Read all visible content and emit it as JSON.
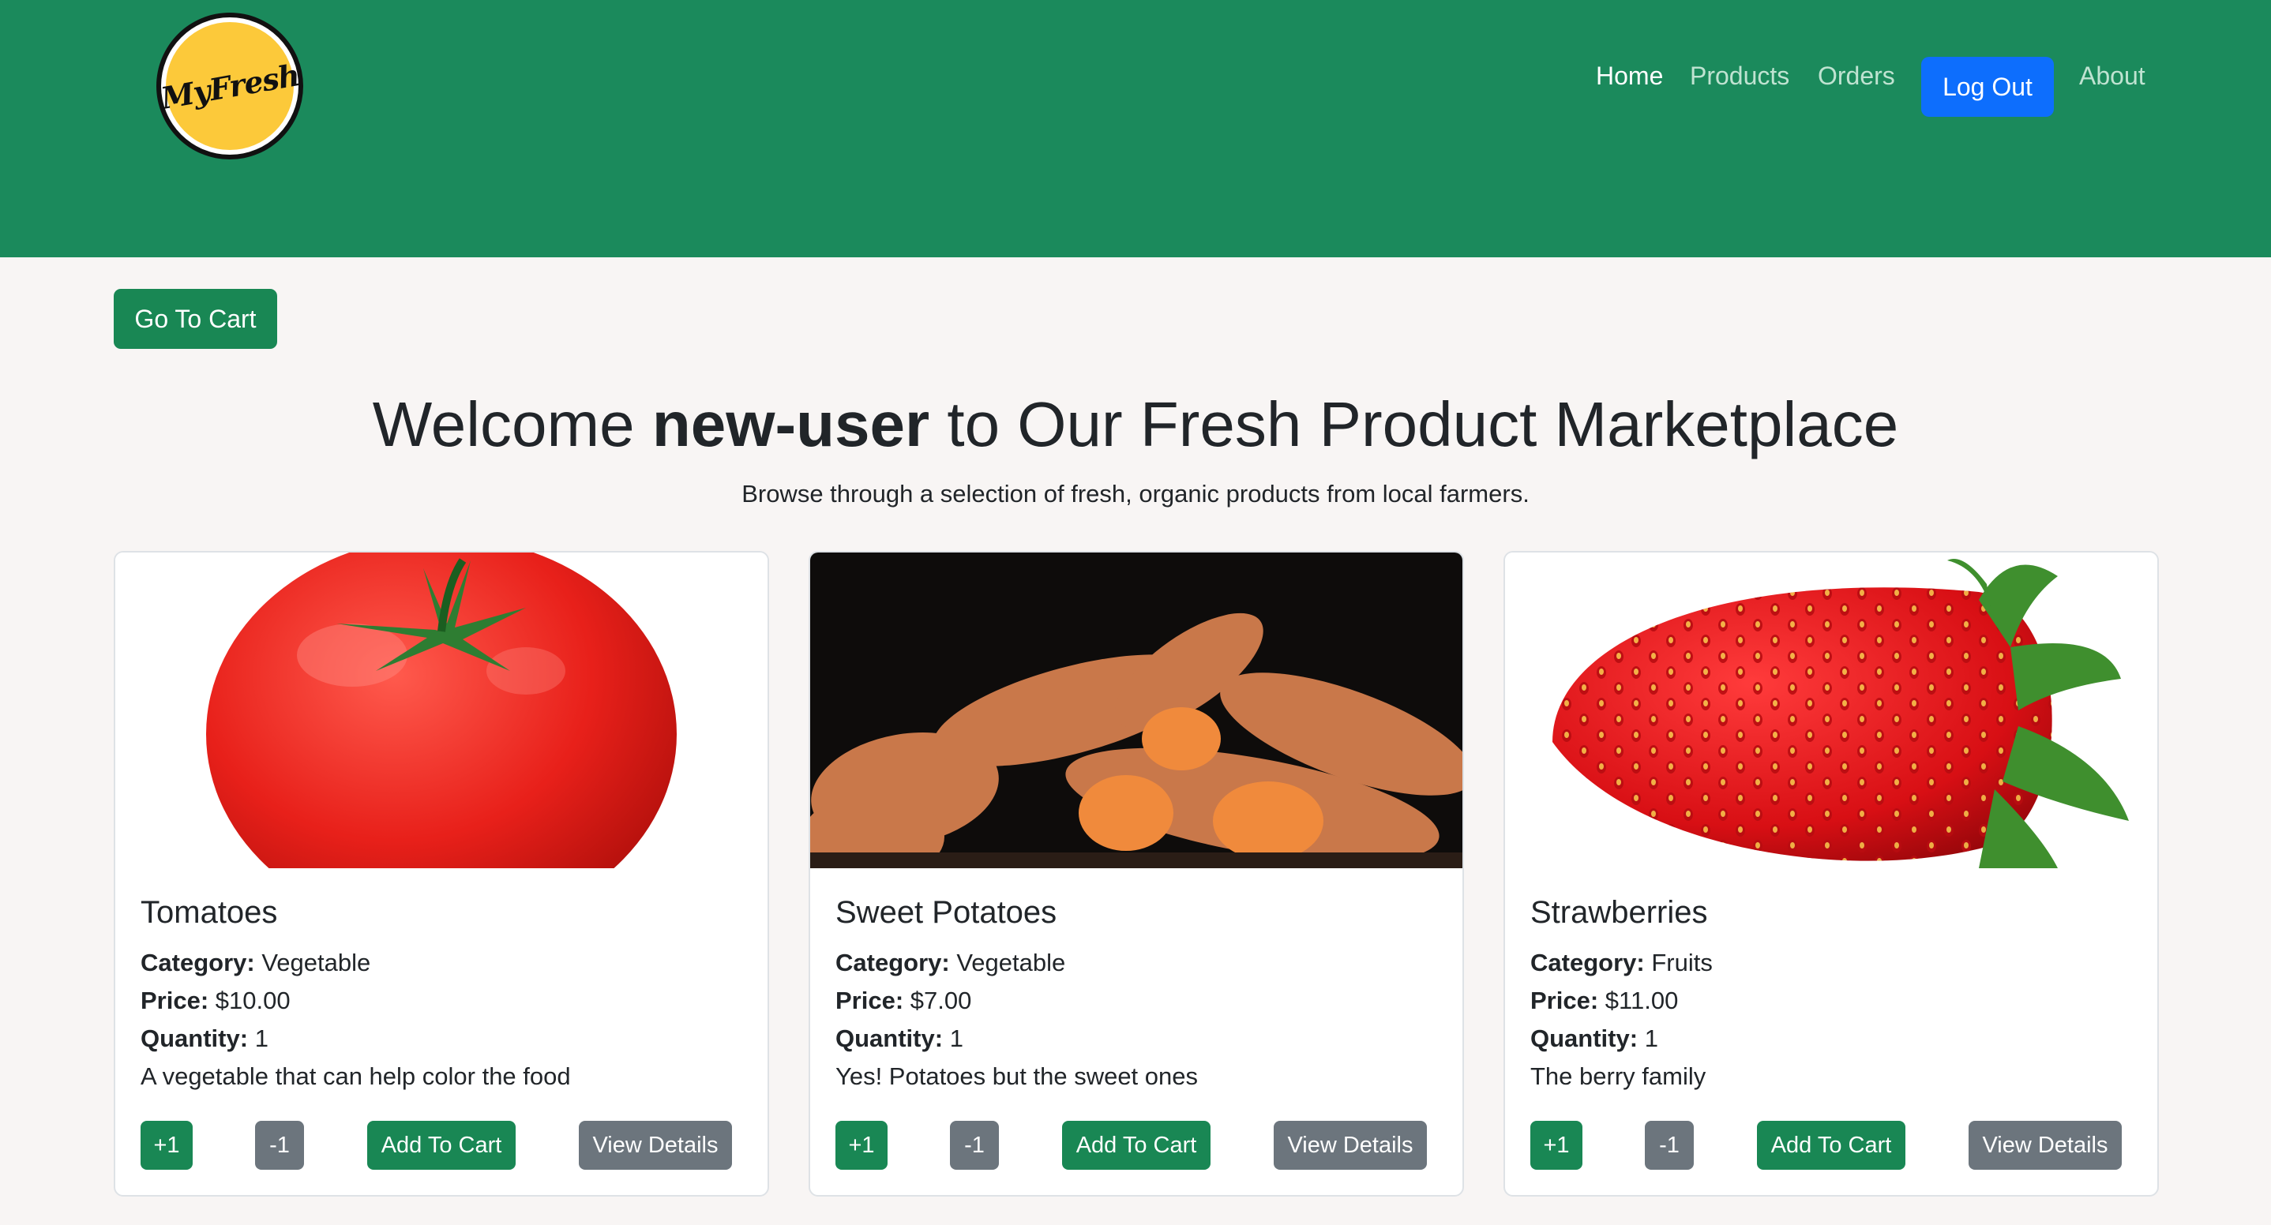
{
  "brand": {
    "logo_text": "MyFresh",
    "primary_color": "#1b8a5c",
    "accent_color": "#0d6efd"
  },
  "nav": {
    "home": "Home",
    "products": "Products",
    "orders": "Orders",
    "logout": "Log Out",
    "about": "About"
  },
  "cart_button": "Go To Cart",
  "heading": {
    "prefix": "Welcome ",
    "username": "new-user",
    "suffix": " to Our Fresh Product Marketplace",
    "subtitle": "Browse through a selection of fresh, organic products from local farmers."
  },
  "labels": {
    "category": "Category:",
    "price": "Price:",
    "quantity": "Quantity:",
    "plus": "+1",
    "minus": "-1",
    "add_to_cart": "Add To Cart",
    "view_details": "View Details"
  },
  "products": [
    {
      "name": "Tomatoes",
      "category": "Vegetable",
      "price": "$10.00",
      "quantity": "1",
      "description": "A vegetable that can help color the food",
      "image": "tomato-image"
    },
    {
      "name": "Sweet Potatoes",
      "category": "Vegetable",
      "price": "$7.00",
      "quantity": "1",
      "description": "Yes! Potatoes but the sweet ones",
      "image": "sweet-potatoes-image"
    },
    {
      "name": "Strawberries",
      "category": "Fruits",
      "price": "$11.00",
      "quantity": "1",
      "description": "The berry family",
      "image": "strawberry-image"
    }
  ]
}
